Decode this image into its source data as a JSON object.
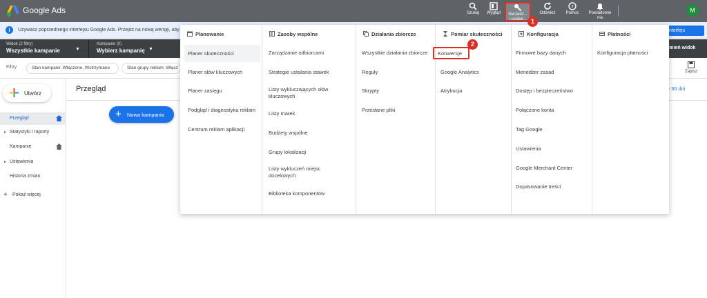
{
  "app": {
    "brand": "Google Ads",
    "avatar_initial": "M"
  },
  "colors": {
    "accent": "#1a73e8",
    "topbar": "#5f6368",
    "highlight": "#d93025"
  },
  "toolbar": {
    "search": "Szukaj",
    "appearance": "Wygląd",
    "tools_line1": "Narzędz...",
    "tools_line2": "i ustawi...",
    "refresh": "Odśwież",
    "help": "Pomoc",
    "notifications_line1": "Powiadomie",
    "notifications_line2": "nia"
  },
  "infobar": {
    "text": "Używasz poprzedniego interfejsu Google Ads. Przejdź na nową wersję, aby",
    "button": "y interfejs"
  },
  "selectors": {
    "view_sub": "Widok (2 filtry)",
    "view_main": "Wszystkie kampanie",
    "campaign_sub": "Kampanie (0)",
    "campaign_main": "Wybierz kampanię",
    "change_view": "Zmień widok"
  },
  "filters": {
    "label": "Filtry",
    "chips": [
      "Stan kampanii: Włączone, Wstrzymane",
      "Stan grupy reklam: Włącz"
    ],
    "save": "Zapisz"
  },
  "sidebar": {
    "create": "Utwórz",
    "items": [
      "Przegląd",
      "Statystyki i raporty",
      "Kampanie",
      "Ustawienia",
      "Historia zmian"
    ],
    "show_more": "Pokaż więcej"
  },
  "main": {
    "title": "Przegląd",
    "new_campaign": "Nowa kampania",
    "date_range": "nie 30 dni"
  },
  "menu": {
    "columns": [
      {
        "heading": "Planowanie",
        "icon": "calendar-icon",
        "items": [
          "Planer skuteczności",
          "Planer słów kluczowych",
          "Planer zasięgu",
          "Podgląd i diagnostyka reklam",
          "Centrum reklam aplikacji"
        ]
      },
      {
        "heading": "Zasoby wspólne",
        "icon": "library-icon",
        "items": [
          "Zarządzanie odbiorcami",
          "Strategie ustalania stawek",
          "Listy wykluczających słów kluczowych",
          "Listy marek",
          "Budżety wspólne",
          "Grupy lokalizacji",
          "Listy wykluczeń miejsc docelowych",
          "Biblioteka komponentów"
        ]
      },
      {
        "heading": "Działania zbiorcze",
        "icon": "copy-icon",
        "items": [
          "Wszystkie działania zbiorcze",
          "Reguły",
          "Skrypty",
          "Przesłane pliki"
        ]
      },
      {
        "heading": "Pomiar skuteczności",
        "icon": "hourglass-icon",
        "items": [
          "Konwersje",
          "Google Analytics",
          "Atrybucja"
        ]
      },
      {
        "heading": "Konfiguracja",
        "icon": "settings-box-icon",
        "items": [
          "Firmowe bazy danych",
          "Menedżer zasad",
          "Dostęp i bezpieczeństwo",
          "Połączone konta",
          "Tag Google",
          "Ustawienia",
          "Google Merchant Center",
          "Dopasowanie treści"
        ]
      },
      {
        "heading": "Płatności",
        "icon": "credit-card-icon",
        "items": [
          "Konfiguracja płatności"
        ]
      }
    ]
  },
  "badges": {
    "one": "1",
    "two": "2"
  }
}
